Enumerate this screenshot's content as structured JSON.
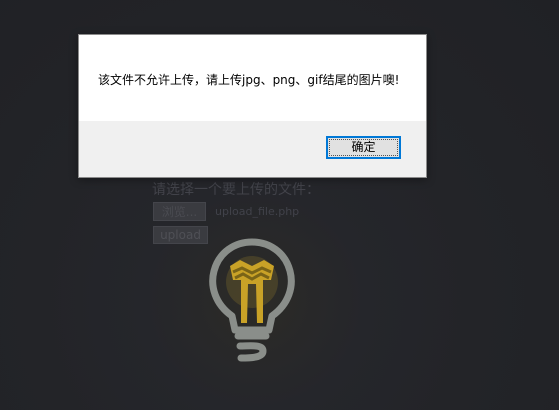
{
  "upload": {
    "title": "请选择一个要上传的文件：",
    "browse_label": "浏览...",
    "file_name": "upload_file.php",
    "upload_label": "upload"
  },
  "dialog": {
    "message": "该文件不允许上传，请上传jpg、png、gif结尾的图片噢!",
    "ok_label": "确定"
  },
  "colors": {
    "dialog_accent": "#0078d7",
    "bulb_gold": "#c9a227",
    "bulb_outline": "#8a8e8a"
  },
  "icons": {
    "bulb": "lightbulb-icon"
  }
}
